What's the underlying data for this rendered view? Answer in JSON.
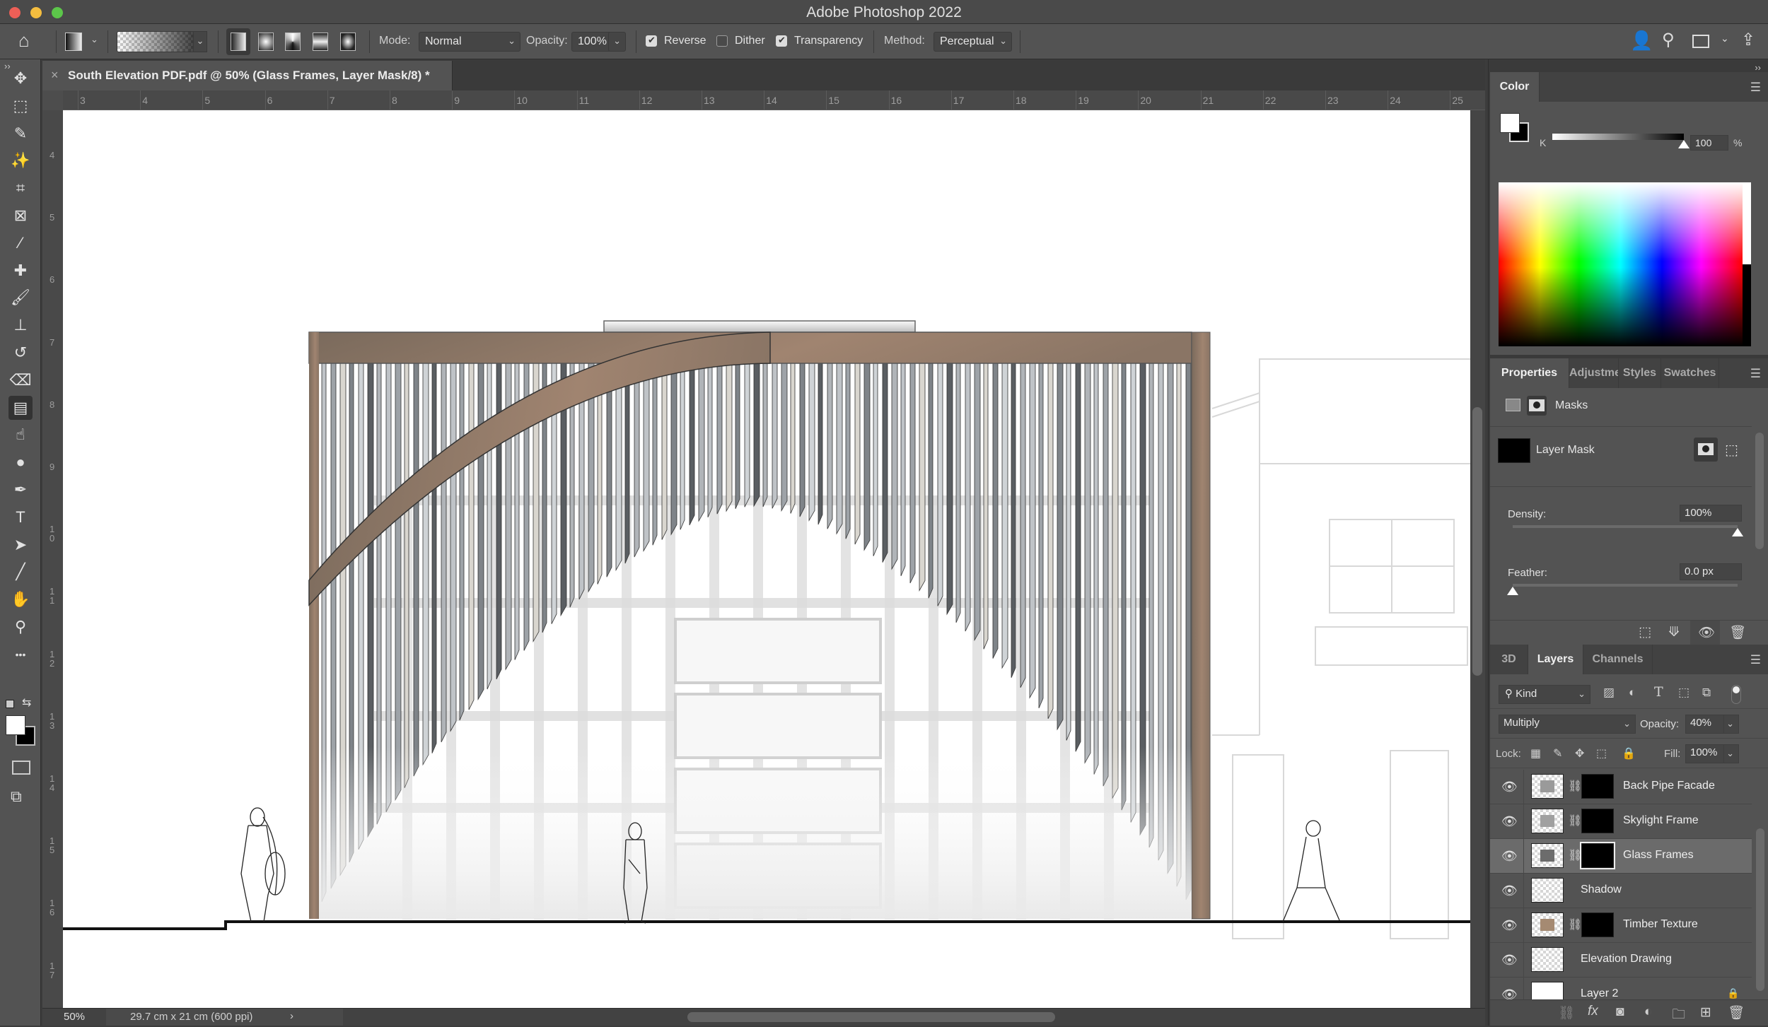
{
  "window": {
    "title": "Adobe Photoshop 2022"
  },
  "options_bar": {
    "mode_label": "Mode:",
    "mode_value": "Normal",
    "opacity_label": "Opacity:",
    "opacity_value": "100%",
    "reverse_label": "Reverse",
    "reverse_checked": true,
    "dither_label": "Dither",
    "dither_checked": false,
    "transparency_label": "Transparency",
    "transparency_checked": true,
    "method_label": "Method:",
    "method_value": "Perceptual",
    "gradient_types": [
      "linear-gradient",
      "radial-gradient",
      "angle-gradient",
      "reflected-gradient",
      "diamond-gradient"
    ],
    "active_gradient_type": "linear-gradient"
  },
  "tools": [
    {
      "name": "move-tool",
      "glyph": "✥"
    },
    {
      "name": "rectangular-marquee-tool",
      "glyph": "⬚"
    },
    {
      "name": "lasso-tool",
      "glyph": "✎"
    },
    {
      "name": "magic-wand-tool",
      "glyph": "✨"
    },
    {
      "name": "crop-tool",
      "glyph": "⌗"
    },
    {
      "name": "frame-tool",
      "glyph": "⊠"
    },
    {
      "name": "eyedropper-tool",
      "glyph": "⁄"
    },
    {
      "name": "healing-brush-tool",
      "glyph": "✚"
    },
    {
      "name": "brush-tool",
      "glyph": "🖌"
    },
    {
      "name": "clone-stamp-tool",
      "glyph": "⊥"
    },
    {
      "name": "history-brush-tool",
      "glyph": "↺"
    },
    {
      "name": "eraser-tool",
      "glyph": "⌫"
    },
    {
      "name": "gradient-tool",
      "glyph": "▤"
    },
    {
      "name": "smudge-tool",
      "glyph": "☝"
    },
    {
      "name": "dodge-tool",
      "glyph": "●"
    },
    {
      "name": "pen-tool",
      "glyph": "✒"
    },
    {
      "name": "type-tool",
      "glyph": "T"
    },
    {
      "name": "path-selection-tool",
      "glyph": "➤"
    },
    {
      "name": "line-tool",
      "glyph": "╱"
    },
    {
      "name": "hand-tool",
      "glyph": "✋"
    },
    {
      "name": "zoom-tool",
      "glyph": "⚲"
    },
    {
      "name": "more-tools",
      "glyph": "•••"
    }
  ],
  "active_tool": "gradient-tool",
  "document": {
    "tab_title": "South Elevation PDF.pdf @ 50% (Glass Frames, Layer Mask/8) *",
    "ruler_h": [
      "3",
      "4",
      "5",
      "6",
      "7",
      "8",
      "9",
      "10",
      "11",
      "12",
      "13",
      "14",
      "15",
      "16",
      "17",
      "18",
      "19",
      "20",
      "21",
      "22",
      "23",
      "24",
      "25"
    ],
    "ruler_v": [
      "4",
      "5",
      "6",
      "7",
      "8",
      "9",
      "10",
      "11",
      "12",
      "13",
      "14",
      "15",
      "16",
      "17"
    ],
    "zoom": "50%",
    "doc_info": "29.7 cm x 21 cm (600 ppi)"
  },
  "color_panel": {
    "title": "Color",
    "slider_label": "K",
    "k_value": "100",
    "unit": "%",
    "foreground": "#ffffff",
    "background": "#000000"
  },
  "properties_panel": {
    "tabs": [
      "Properties",
      "Adjustme",
      "Styles",
      "Swatches"
    ],
    "active_tab": "Properties",
    "section": "Masks",
    "mask_label": "Layer Mask",
    "density_label": "Density:",
    "density_value": "100%",
    "density_fraction": 1.0,
    "feather_label": "Feather:",
    "feather_value": "0.0 px",
    "feather_fraction": 0.0
  },
  "layers_panel": {
    "tabs": [
      "3D",
      "Layers",
      "Channels"
    ],
    "active_tab": "Layers",
    "filter_label": "Kind",
    "blend_mode": "Multiply",
    "opacity_label": "Opacity:",
    "opacity_value": "40%",
    "lock_label": "Lock:",
    "fill_label": "Fill:",
    "fill_value": "100%",
    "layers": [
      {
        "name": "Back Pipe Facade",
        "visible": true,
        "has_mask": true,
        "selected": false
      },
      {
        "name": "Skylight Frame",
        "visible": true,
        "has_mask": true,
        "selected": false
      },
      {
        "name": "Glass Frames",
        "visible": true,
        "has_mask": true,
        "selected": true
      },
      {
        "name": "Shadow",
        "visible": true,
        "has_mask": false,
        "selected": false
      },
      {
        "name": "Timber Texture",
        "visible": true,
        "has_mask": true,
        "selected": false
      },
      {
        "name": "Elevation Drawing",
        "visible": true,
        "has_mask": false,
        "selected": false
      },
      {
        "name": "Layer 2",
        "visible": true,
        "has_mask": false,
        "selected": false,
        "locked": true
      }
    ]
  }
}
